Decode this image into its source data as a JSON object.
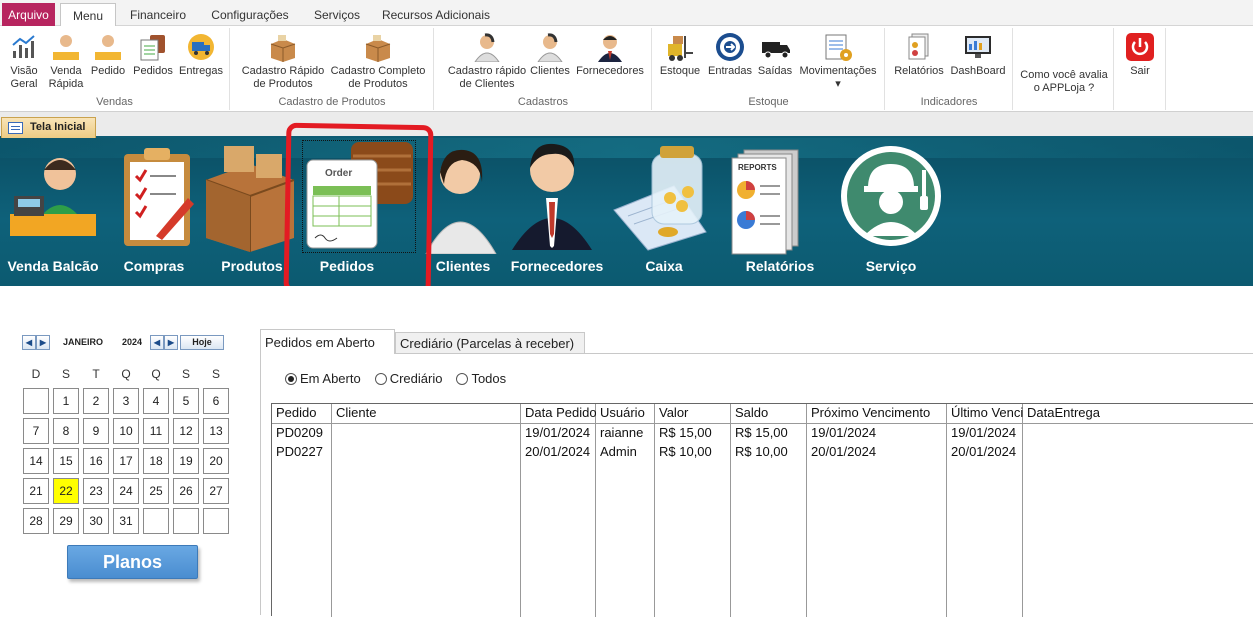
{
  "menubar": {
    "tabs": [
      "Arquivo",
      "Menu",
      "Financeiro",
      "Configurações",
      "Serviços",
      "Recursos Adicionais"
    ]
  },
  "ribbon": {
    "groups": [
      {
        "label": "Vendas",
        "buttons": [
          {
            "line1": "Visão",
            "line2": "Geral",
            "icon": "overview-icon"
          },
          {
            "line1": "Venda",
            "line2": "Rápida",
            "icon": "quick-sale-icon"
          },
          {
            "line1": "Pedido",
            "line2": "",
            "icon": "order-icon"
          },
          {
            "line1": "Pedidos",
            "line2": "",
            "icon": "orders-icon"
          },
          {
            "line1": "Entregas",
            "line2": "",
            "icon": "delivery-truck-icon"
          }
        ]
      },
      {
        "label": "Cadastro de Produtos",
        "buttons": [
          {
            "line1": "Cadastro Rápido",
            "line2": "de Produtos",
            "icon": "box-icon"
          },
          {
            "line1": "Cadastro Completo",
            "line2": "de Produtos",
            "icon": "box-icon"
          }
        ]
      },
      {
        "label": "Cadastros",
        "buttons": [
          {
            "line1": "Cadastro rápido",
            "line2": "de Clientes",
            "icon": "person-icon"
          },
          {
            "line1": "Clientes",
            "line2": "",
            "icon": "person-icon"
          },
          {
            "line1": "Fornecedores",
            "line2": "",
            "icon": "businessman-icon"
          }
        ]
      },
      {
        "label": "Estoque",
        "buttons": [
          {
            "line1": "Estoque",
            "line2": "",
            "icon": "forklift-icon"
          },
          {
            "line1": "Entradas",
            "line2": "",
            "icon": "entry-icon"
          },
          {
            "line1": "Saídas",
            "line2": "",
            "icon": "truck-icon"
          },
          {
            "line1": "Movimentações",
            "line2": "▾",
            "icon": "movements-icon"
          }
        ]
      },
      {
        "label": "Indicadores",
        "buttons": [
          {
            "line1": "Relatórios",
            "line2": "",
            "icon": "reports-icon"
          },
          {
            "line1": "DashBoard",
            "line2": "",
            "icon": "dashboard-icon"
          }
        ]
      },
      {
        "label": "",
        "buttons": [
          {
            "line1": "Como você avalia",
            "line2": "o APPLoja ?",
            "icon": ""
          }
        ]
      },
      {
        "label": "",
        "buttons": [
          {
            "line1": "Sair",
            "line2": "",
            "icon": "power-icon"
          }
        ]
      }
    ]
  },
  "doc_tab": "Tela Inicial",
  "banner": {
    "items": [
      "Venda Balcão",
      "Compras",
      "Produtos",
      "Pedidos",
      "Clientes",
      "Fornecedores",
      "Caixa",
      "Relatórios",
      "Serviço"
    ]
  },
  "calendar": {
    "month": "JANEIRO",
    "year": "2024",
    "today_button": "Hoje",
    "weekdays": [
      "D",
      "S",
      "T",
      "Q",
      "Q",
      "S",
      "S"
    ],
    "weeks": [
      [
        "",
        "1",
        "2",
        "3",
        "4",
        "5",
        "6"
      ],
      [
        "7",
        "8",
        "9",
        "10",
        "11",
        "12",
        "13"
      ],
      [
        "14",
        "15",
        "16",
        "17",
        "18",
        "19",
        "20"
      ],
      [
        "21",
        "22",
        "23",
        "24",
        "25",
        "26",
        "27"
      ],
      [
        "28",
        "29",
        "30",
        "31",
        "",
        "",
        ""
      ]
    ],
    "today": "22"
  },
  "planos_button": "Planos",
  "tabs": [
    "Pedidos em Aberto",
    "Crediário (Parcelas à receber)"
  ],
  "filters": {
    "options": [
      "Em Aberto",
      "Crediário",
      "Todos"
    ],
    "selected": "Em Aberto"
  },
  "table": {
    "columns": [
      "Pedido",
      "Cliente",
      "Data Pedido",
      "Usuário",
      "Valor",
      "Saldo",
      "Próximo Vencimento",
      "Último Vencimento",
      "DataEntrega"
    ],
    "rows": [
      [
        "PD0209",
        "",
        "19/01/2024",
        "raianne",
        "R$ 15,00",
        "R$ 15,00",
        "19/01/2024",
        "19/01/2024",
        ""
      ],
      [
        "PD0227",
        "",
        "20/01/2024",
        "Admin",
        "R$ 10,00",
        "R$ 10,00",
        "20/01/2024",
        "20/01/2024",
        ""
      ]
    ]
  },
  "colors": {
    "file_tab": "#b7255f",
    "banner": "#0e617a",
    "highlight": "#ffff00",
    "annotation": "#e31b23"
  }
}
